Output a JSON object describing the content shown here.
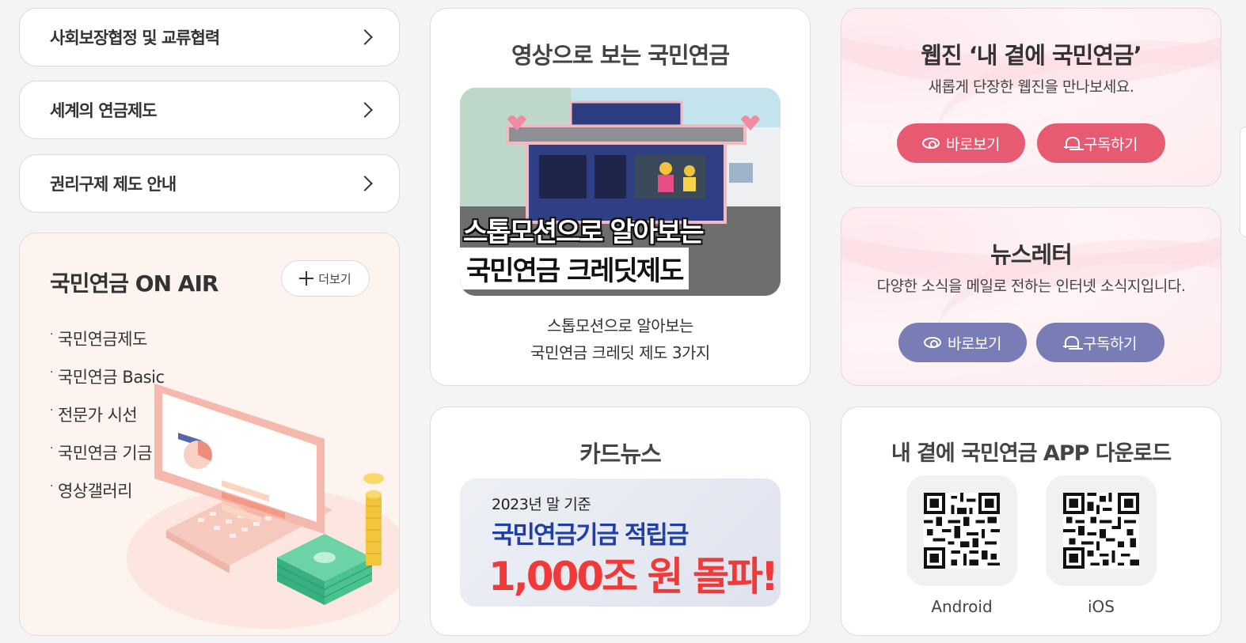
{
  "left_links": [
    {
      "label": "사회보장협정 및 교류협력"
    },
    {
      "label": "세계의 연금제도"
    },
    {
      "label": "권리구제 제도 안내"
    }
  ],
  "onair": {
    "title": "국민연금 ON AIR",
    "more_label": "더보기",
    "items": [
      "국민연금제도",
      "국민연금 Basic",
      "전문가 시선",
      "국민연금 기금",
      "영상갤러리"
    ]
  },
  "video": {
    "title": "영상으로 보는 국민연금",
    "thumb_caption_line1": "스톱모션으로 알아보는",
    "thumb_caption_line2": "국민연금 크레딧제도",
    "caption_line1": "스톱모션으로 알아보는",
    "caption_line2": "국민연금 크레딧 제도 3가지"
  },
  "card_news": {
    "title": "카드뉴스",
    "banner_line1": "2023년 말 기준",
    "banner_line2": "국민연금기금 적립금",
    "banner_line3": "1,000조 원 돌파!"
  },
  "webzine": {
    "title": "웹진 ‘내 곁에 국민연금’",
    "desc": "새롭게 단장한 웹진을 만나보세요.",
    "view_label": "바로보기",
    "subscribe_label": "구독하기",
    "accent": "#e85a72"
  },
  "newsletter": {
    "title": "뉴스레터",
    "desc": "다양한 소식을 메일로 전하는 인터넷 소식지입니다.",
    "view_label": "바로보기",
    "subscribe_label": "구독하기",
    "accent": "#7a7db5"
  },
  "app": {
    "title": "내 곁에 국민연금 APP 다운로드",
    "android_label": "Android",
    "ios_label": "iOS"
  }
}
